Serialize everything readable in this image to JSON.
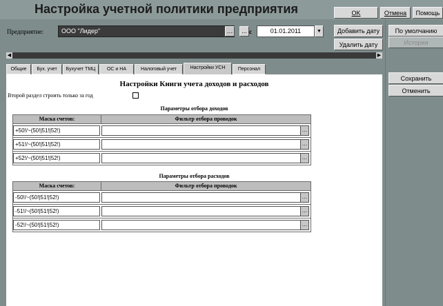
{
  "window": {
    "title": "Настройка учетной политики предприятия",
    "ok_label": "OK",
    "cancel_label": "Отмена",
    "help_label": "Помощь"
  },
  "header": {
    "enterprise_label": "Предприятие:",
    "enterprise_value": "ООО \"Лидер\"",
    "from_label": "с",
    "date_value": "01.01.2011",
    "add_date_label": "Добавить дату",
    "delete_date_label": "Удалить дату",
    "ellipsis": "..."
  },
  "sidepanel": {
    "default_label": "По умолчанию",
    "history_label": "История",
    "save_label": "Сохранить",
    "cancel_label": "Отменить"
  },
  "tabs": [
    {
      "label": "Общие"
    },
    {
      "label": "Бух. учет"
    },
    {
      "label": "Бухучет ТМЦ"
    },
    {
      "label": "ОС и НА"
    },
    {
      "label": "Налоговый учет"
    },
    {
      "label": "Настройки УСН"
    },
    {
      "label": "Персонал"
    }
  ],
  "active_tab": "Настройки УСН",
  "content": {
    "title": "Настройки Книги учета доходов и расходов",
    "checkbox_label": "Второй раздел строить только за год",
    "checkbox_checked": false,
    "income": {
      "section_title": "Параметры отбора доходов",
      "col_mask": "Маска счетов:",
      "col_filter": "Фильтр отбора проводок",
      "rows": [
        {
          "mask": "+50!/~(50!|51!|52!)",
          "filter": ""
        },
        {
          "mask": "+51!/~(50!|51!|52!)",
          "filter": ""
        },
        {
          "mask": "+52!/~(50!|51!|52!)",
          "filter": ""
        }
      ]
    },
    "expense": {
      "section_title": "Параметры отбора расходов",
      "col_mask": "Маска счетов:",
      "col_filter": "Фильтр отбора проводок",
      "rows": [
        {
          "mask": "-50!/~(50!|51!|52!)",
          "filter": ""
        },
        {
          "mask": "-51!/~(50!|51!|52!)",
          "filter": ""
        },
        {
          "mask": "-52!/~(50!|51!|52!)",
          "filter": ""
        }
      ]
    }
  }
}
